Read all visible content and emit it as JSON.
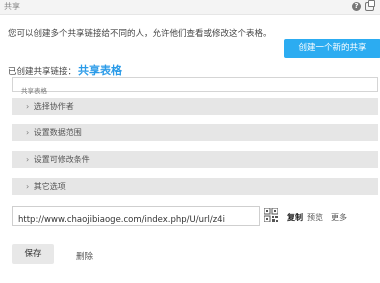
{
  "dialog": {
    "title": "共享",
    "icons": [
      "help-icon",
      "maximize-icon"
    ]
  },
  "intro_text": "您可以创建多个共享链接给不同的人，允许他们查看或修改这个表格。",
  "create_button": "创建一个新的共享",
  "created_label": "已创建共享链接：",
  "created_sheet_name": "共享表格",
  "name_input": {
    "placeholder": "共享表格",
    "value": ""
  },
  "sections": [
    {
      "label": "选择协作者"
    },
    {
      "label": "设置数据范围"
    },
    {
      "label": "设置可修改条件"
    },
    {
      "label": "其它选项"
    }
  ],
  "share_url": "http://www.chaojibiaoge.com/index.php/U/url/z4i",
  "actions": {
    "copy": "复制",
    "preview": "预览",
    "more": "更多"
  },
  "footer": {
    "save": "保存",
    "delete": "删除"
  },
  "colors": {
    "accent": "#2cacf1",
    "link": "#2a9be8",
    "section_bg": "#e6e6e6"
  }
}
